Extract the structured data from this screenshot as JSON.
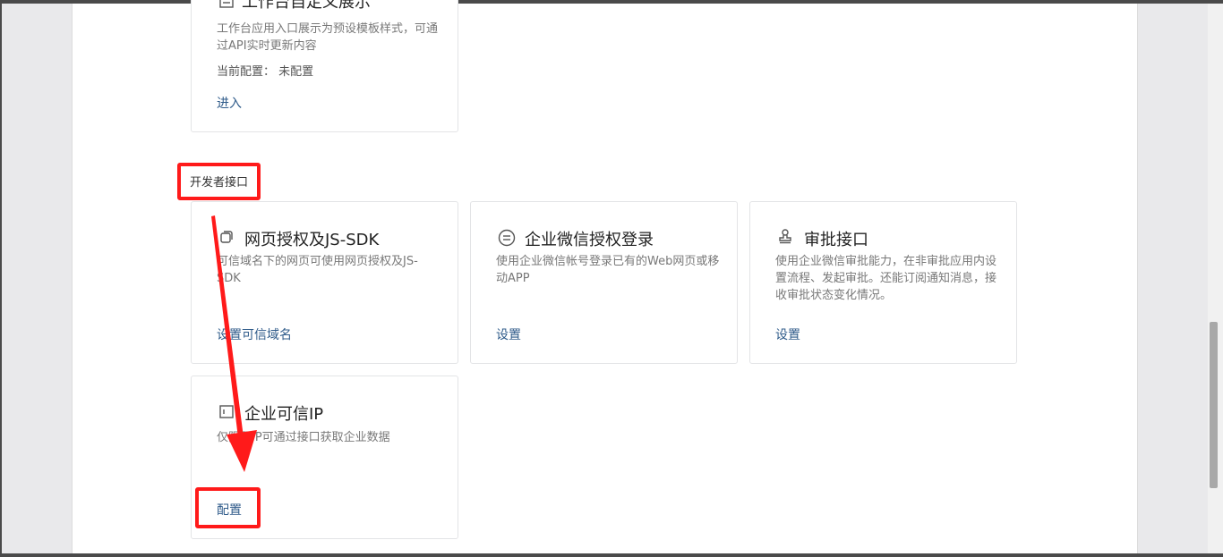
{
  "workbench_card": {
    "title": "工作台自定义展示",
    "desc": "工作台应用入口展示为预设模板样式，可通过API实时更新内容",
    "config_label": "当前配置：",
    "config_value": "未配置",
    "action": "进入"
  },
  "developer_section": {
    "label": "开发者接口",
    "cards": [
      {
        "title": "网页授权及JS-SDK",
        "desc": "可信域名下的网页可使用网页授权及JS-SDK",
        "action": "设置可信域名",
        "icon": "refresh-square-icon"
      },
      {
        "title": "企业微信授权登录",
        "desc": "使用企业微信帐号登录已有的Web网页或移动APP",
        "action": "设置",
        "icon": "equal-circle-icon"
      },
      {
        "title": "审批接口",
        "desc": "使用企业微信审批能力，在非审批应用内设置流程、发起审批。还能订阅通知消息，接收审批状态变化情况。",
        "action": "设置",
        "icon": "stamp-icon"
      },
      {
        "title": "企业可信IP",
        "desc": "仅限配IP可通过接口获取企业数据",
        "action": "配置",
        "icon": "document-icon"
      }
    ]
  },
  "annotation": {
    "color": "#ff1a1a"
  }
}
